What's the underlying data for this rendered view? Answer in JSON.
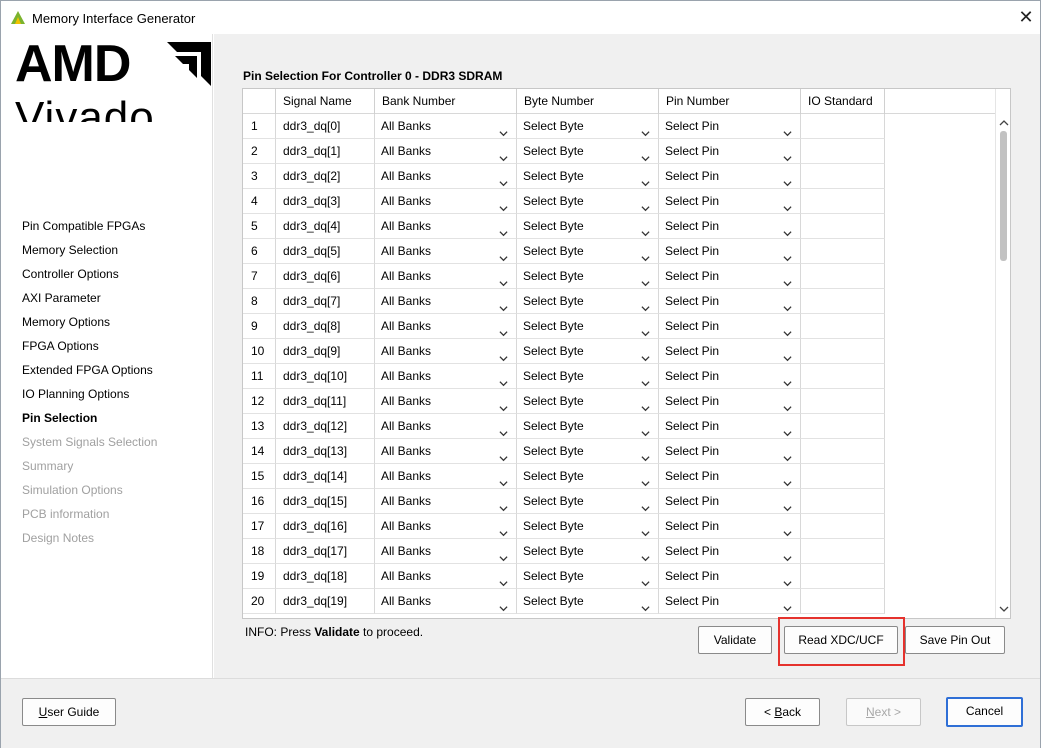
{
  "window": {
    "title": "Memory Interface Generator"
  },
  "logo": {
    "brand": "AMD",
    "product": "Vivado"
  },
  "nav": [
    {
      "label": "Pin Compatible FPGAs",
      "state": "normal"
    },
    {
      "label": "Memory Selection",
      "state": "normal"
    },
    {
      "label": "Controller Options",
      "state": "normal"
    },
    {
      "label": "AXI Parameter",
      "state": "normal"
    },
    {
      "label": "Memory Options",
      "state": "normal"
    },
    {
      "label": "FPGA Options",
      "state": "normal"
    },
    {
      "label": "Extended FPGA Options",
      "state": "normal"
    },
    {
      "label": "IO Planning Options",
      "state": "normal"
    },
    {
      "label": "Pin Selection",
      "state": "active"
    },
    {
      "label": "System Signals Selection",
      "state": "disabled"
    },
    {
      "label": "Summary",
      "state": "disabled"
    },
    {
      "label": "Simulation Options",
      "state": "disabled"
    },
    {
      "label": "PCB information",
      "state": "disabled"
    },
    {
      "label": "Design Notes",
      "state": "disabled"
    }
  ],
  "section": {
    "title": "Pin Selection For Controller 0 - DDR3 SDRAM"
  },
  "table": {
    "headers": [
      "",
      "Signal Name",
      "Bank Number",
      "Byte Number",
      "Pin Number",
      "IO Standard"
    ],
    "rows": [
      {
        "index": "1",
        "signal": "ddr3_dq[0]",
        "bank": "All Banks",
        "byte": "Select Byte",
        "pin": "Select Pin",
        "io": ""
      },
      {
        "index": "2",
        "signal": "ddr3_dq[1]",
        "bank": "All Banks",
        "byte": "Select Byte",
        "pin": "Select Pin",
        "io": ""
      },
      {
        "index": "3",
        "signal": "ddr3_dq[2]",
        "bank": "All Banks",
        "byte": "Select Byte",
        "pin": "Select Pin",
        "io": ""
      },
      {
        "index": "4",
        "signal": "ddr3_dq[3]",
        "bank": "All Banks",
        "byte": "Select Byte",
        "pin": "Select Pin",
        "io": ""
      },
      {
        "index": "5",
        "signal": "ddr3_dq[4]",
        "bank": "All Banks",
        "byte": "Select Byte",
        "pin": "Select Pin",
        "io": ""
      },
      {
        "index": "6",
        "signal": "ddr3_dq[5]",
        "bank": "All Banks",
        "byte": "Select Byte",
        "pin": "Select Pin",
        "io": ""
      },
      {
        "index": "7",
        "signal": "ddr3_dq[6]",
        "bank": "All Banks",
        "byte": "Select Byte",
        "pin": "Select Pin",
        "io": ""
      },
      {
        "index": "8",
        "signal": "ddr3_dq[7]",
        "bank": "All Banks",
        "byte": "Select Byte",
        "pin": "Select Pin",
        "io": ""
      },
      {
        "index": "9",
        "signal": "ddr3_dq[8]",
        "bank": "All Banks",
        "byte": "Select Byte",
        "pin": "Select Pin",
        "io": ""
      },
      {
        "index": "10",
        "signal": "ddr3_dq[9]",
        "bank": "All Banks",
        "byte": "Select Byte",
        "pin": "Select Pin",
        "io": ""
      },
      {
        "index": "11",
        "signal": "ddr3_dq[10]",
        "bank": "All Banks",
        "byte": "Select Byte",
        "pin": "Select Pin",
        "io": ""
      },
      {
        "index": "12",
        "signal": "ddr3_dq[11]",
        "bank": "All Banks",
        "byte": "Select Byte",
        "pin": "Select Pin",
        "io": ""
      },
      {
        "index": "13",
        "signal": "ddr3_dq[12]",
        "bank": "All Banks",
        "byte": "Select Byte",
        "pin": "Select Pin",
        "io": ""
      },
      {
        "index": "14",
        "signal": "ddr3_dq[13]",
        "bank": "All Banks",
        "byte": "Select Byte",
        "pin": "Select Pin",
        "io": ""
      },
      {
        "index": "15",
        "signal": "ddr3_dq[14]",
        "bank": "All Banks",
        "byte": "Select Byte",
        "pin": "Select Pin",
        "io": ""
      },
      {
        "index": "16",
        "signal": "ddr3_dq[15]",
        "bank": "All Banks",
        "byte": "Select Byte",
        "pin": "Select Pin",
        "io": ""
      },
      {
        "index": "17",
        "signal": "ddr3_dq[16]",
        "bank": "All Banks",
        "byte": "Select Byte",
        "pin": "Select Pin",
        "io": ""
      },
      {
        "index": "18",
        "signal": "ddr3_dq[17]",
        "bank": "All Banks",
        "byte": "Select Byte",
        "pin": "Select Pin",
        "io": ""
      },
      {
        "index": "19",
        "signal": "ddr3_dq[18]",
        "bank": "All Banks",
        "byte": "Select Byte",
        "pin": "Select Pin",
        "io": ""
      },
      {
        "index": "20",
        "signal": "ddr3_dq[19]",
        "bank": "All Banks",
        "byte": "Select Byte",
        "pin": "Select Pin",
        "io": ""
      }
    ]
  },
  "info": {
    "prefix": "INFO: Press ",
    "keyword": "Validate",
    "suffix": " to proceed."
  },
  "actions": {
    "validate": "Validate",
    "read_xdc": "Read XDC/UCF",
    "save_pin_out": "Save Pin Out"
  },
  "footer": {
    "user_guide": {
      "mnemonic": "U",
      "rest": "ser Guide"
    },
    "back": {
      "prefix": "< ",
      "mnemonic": "B",
      "rest": "ack"
    },
    "next": {
      "mnemonic": "N",
      "rest": "ext >"
    },
    "cancel": "Cancel"
  },
  "colors": {
    "accent": "#2f6fd6",
    "highlight": "#e5322d",
    "amd_logo_green": "#d9a400"
  },
  "icons": {
    "close": "close-icon",
    "dropdown": "chevron-down-icon",
    "app": "vivado-app-icon"
  }
}
